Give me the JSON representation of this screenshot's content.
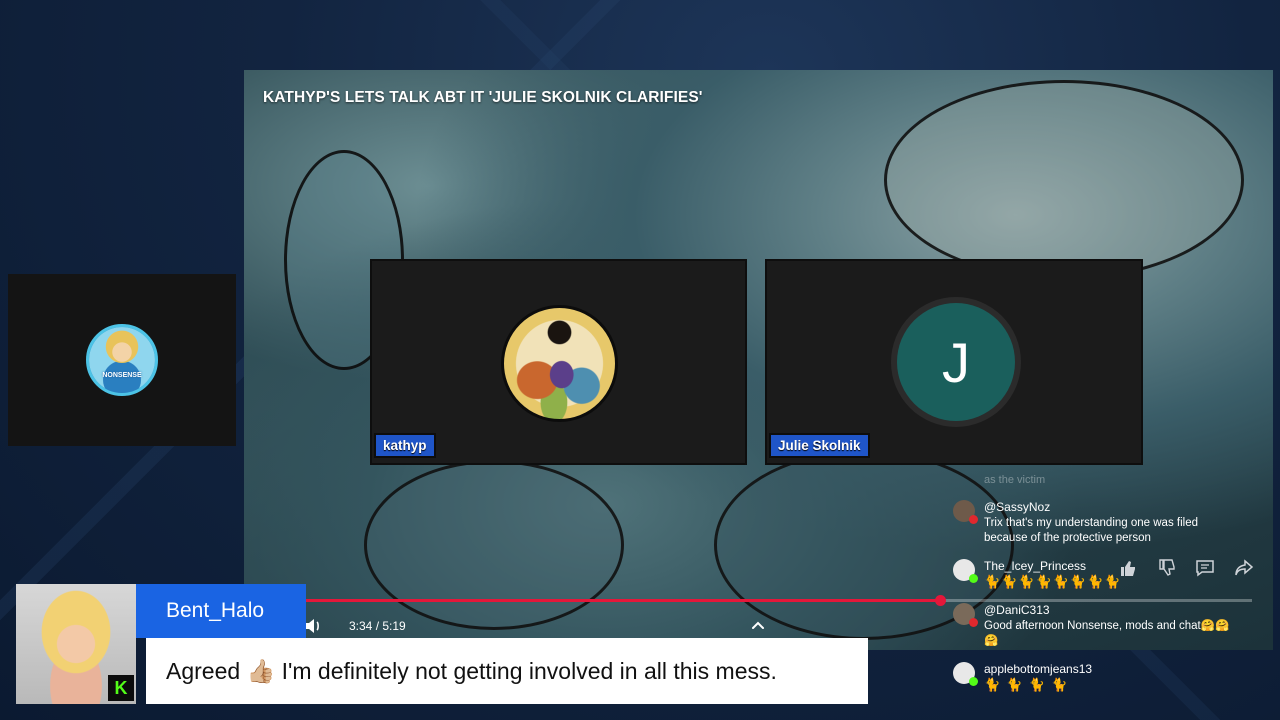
{
  "video": {
    "title": "KATHYP'S LETS TALK ABT IT 'JULIE SKOLNIK CLARIFIES'"
  },
  "participants": [
    {
      "name": "kathyp",
      "avatar": "mermaid-illustration"
    },
    {
      "name": "Julie Skolnik",
      "initial": "J",
      "avatar_color": "#1a5f5c"
    }
  ],
  "side_tile": {
    "avatar_label": "NONSENSE"
  },
  "player": {
    "current_time": "3:34",
    "separator": "/",
    "duration": "5:19",
    "time_display": "3:34 / 5:19",
    "progress_fraction": 0.67,
    "accent_color": "#e4173a"
  },
  "chat": {
    "faded_message": "as the victim",
    "messages": [
      {
        "user": "@SassyNoz",
        "text": "Trix that's my understanding one was filed because of the protective person",
        "badge_color": "#e0282e"
      },
      {
        "user": "The_Icey_Princess",
        "text": "🐈🐈🐈🐈🐈🐈🐈🐈",
        "badge_color": "#53fc18"
      },
      {
        "user": "@DaniC313",
        "text": "Good afternoon Nonsense, mods and chat🤗🤗🤗",
        "badge_color": "#e0282e"
      },
      {
        "user": "applebottomjeans13",
        "text": "🐈 🐈 🐈 🐈",
        "badge_color": "#53fc18"
      }
    ],
    "actions": [
      "thumbs-up-icon",
      "thumbs-down-icon",
      "comment-icon",
      "share-icon"
    ]
  },
  "lower_third": {
    "username": "Bent_Halo",
    "message": "Agreed 👍🏼 I'm definitely not getting involved in all this mess.",
    "platform_badge": "K",
    "name_bg": "#1a64e3"
  }
}
